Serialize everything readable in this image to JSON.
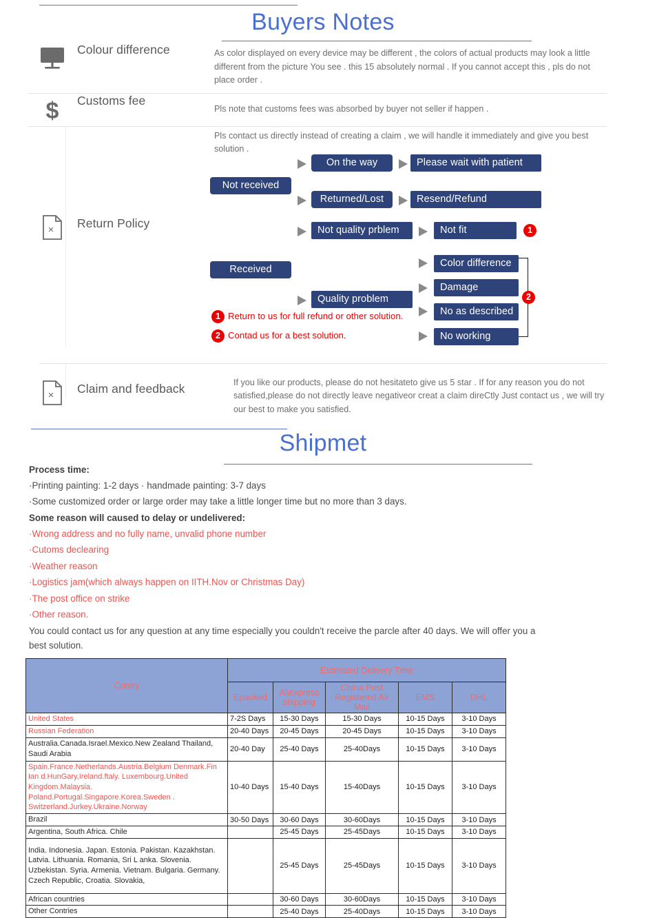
{
  "buyers_notes": {
    "title": "Buyers Notes",
    "rows": [
      {
        "icon": "monitor-icon",
        "label": "Colour difference",
        "body": "As color displayed on every device may be different , the colors of actual products may look a little different from the picture You see . this 15 absolutely normal . If you cannot accept this , pls do not place order ."
      },
      {
        "icon": "dollar-icon",
        "label": "Customs fee",
        "body": "Pls note that customs fees was absorbed by buyer not seller if happen ."
      },
      {
        "icon": "document-x-icon",
        "label": "Return Policy",
        "body": "Pls contact us directly instead of creating a claim , we will handle it immediately and give you best solution ."
      },
      {
        "icon": "document-x-icon",
        "label": "Claim and feedback",
        "body": "If you like our products,  please do not hesitateto give us 5 star . If for any reason you do not satisfied,please do not directly leave negativeor creat a claim direCtly Just contact us , we will try our best to make you satisfied."
      }
    ]
  },
  "flowchart": {
    "boxes": {
      "not_received": "Not received",
      "received": "Received",
      "on_the_way": "On the way",
      "returned_lost": "Returned/Lost",
      "not_quality_problem": "Not quality prblem",
      "quality_problem": "Quality problem",
      "please_wait": "Please wait with patient",
      "resend_refund": "Resend/Refund",
      "not_fit": "Not fit",
      "color_difference": "Color difference",
      "damage": "Damage",
      "no_as_described": "No as described",
      "no_working": "No working"
    },
    "badges": {
      "one": "1",
      "two": "2"
    },
    "legend": [
      {
        "marker": "1",
        "text": "Return to us for full refund or other solution."
      },
      {
        "marker": "2",
        "text": "Contad us for a best solution."
      }
    ],
    "colors": {
      "box": "#2e4379",
      "badge": "#ee0000",
      "arrow": "#8a8a8a"
    }
  },
  "shipment": {
    "title": "Shipmet",
    "lines": [
      {
        "text": "Process time:",
        "style": "head"
      },
      {
        "text": "·Printing painting: 1-2 days · handmade painting: 3-7 days",
        "style": "plain"
      },
      {
        "text": "·Some customized order or large order may take a little longer time but no more than 3 days.",
        "style": "plain"
      },
      {
        "text": "Some reason will caused to delay or undelivered:",
        "style": "head"
      },
      {
        "text": "·Wrong address and no fully name, unvalid phone number",
        "style": "red"
      },
      {
        "text": "·Cutoms declearing",
        "style": "red"
      },
      {
        "text": "·Weather reason",
        "style": "red"
      },
      {
        "text": "·Logistics jam(which always happen on IITH.Nov or Christmas Day)",
        "style": "red"
      },
      {
        "text": "·The post office on strike",
        "style": "red"
      },
      {
        "text": "·Other reason.",
        "style": "red"
      },
      {
        "text": "You could contact us for any question at any time especially you couldn't receive the parcle after 40 days. We will offer you a best solution.",
        "style": "tail"
      }
    ]
  },
  "delivery_table": {
    "header": {
      "country": "Contry",
      "group": "Estimated Delivery Time",
      "columns": [
        "Epacked",
        "Aliexpress shipping",
        "China Post Registered Air Mail",
        "EMS",
        "DHL"
      ]
    },
    "rows": [
      {
        "country": "United States",
        "red": true,
        "values": [
          "7-2S Days",
          "15-30 Days",
          "15-30 Days",
          "10-15 Days",
          "3-10 Days"
        ]
      },
      {
        "country": "Russian Federation",
        "red": true,
        "values": [
          "20-40 Days",
          "20-45 Days",
          "20-45 Days",
          "10-15 Days",
          "3-10 Days"
        ]
      },
      {
        "country": "Australia.Canada.Israel.Mexico.New Zealand Thailand, Saudi Arabia",
        "red": false,
        "values": [
          "20-40 Day",
          "25-40 Days",
          "25-40Days",
          "10-15 Days",
          "3-10 Days"
        ]
      },
      {
        "country": "Spain.France.Netherlands.Austria.Belgium Denmark.Fin Ian d.HunGary,Ireland.ftaly. Luxembourg.United Kingdom.Malaysia. Poland.Portugal.Singapore.Korea.Sweden . Switzerland.Jurkey.Ukraine.Norway",
        "red": true,
        "values": [
          "10-40 Days",
          "15-40 Days",
          "15-40Days",
          "10-15 Days",
          "3-10 Days"
        ]
      },
      {
        "country": "Brazil",
        "red": false,
        "values": [
          "30-50 Days",
          "30-60 Days",
          "30-60Days",
          "10-15 Days",
          "3-10 Days"
        ]
      },
      {
        "country": "Argentina, South Africa. Chile",
        "red": false,
        "values": [
          "",
          "25-45 Days",
          "25-45Days",
          "10-15 Days",
          "3-10 Days"
        ]
      },
      {
        "country": "India. Indonesia. Japan. Estonia. Pakistan. Kazakhstan. Latvia. Lithuania. Romania, Sri L anka. Slovenia. Uzbekistan. Syria. Armenia. Vietnam. Bulgaria. Germany. Czech Republic, Croatia. Slovakia,",
        "red": false,
        "values": [
          "",
          "25-45 Days",
          "25-45Days",
          "10-15 Days",
          "3-10 Days"
        ]
      },
      {
        "country": "African countries",
        "red": false,
        "values": [
          "",
          "30-60 Days",
          "30-60Days",
          "10-15 Days",
          "3-10 Days"
        ]
      },
      {
        "country": "Other Contries",
        "red": false,
        "values": [
          "",
          "25-40 Days",
          "25-40Days",
          "10-15 Days",
          "3-10 Days"
        ]
      }
    ],
    "colors": {
      "header_bg": "#8da3d6",
      "header_text": "#f26a6a",
      "accent_text": "#ef5350"
    }
  }
}
